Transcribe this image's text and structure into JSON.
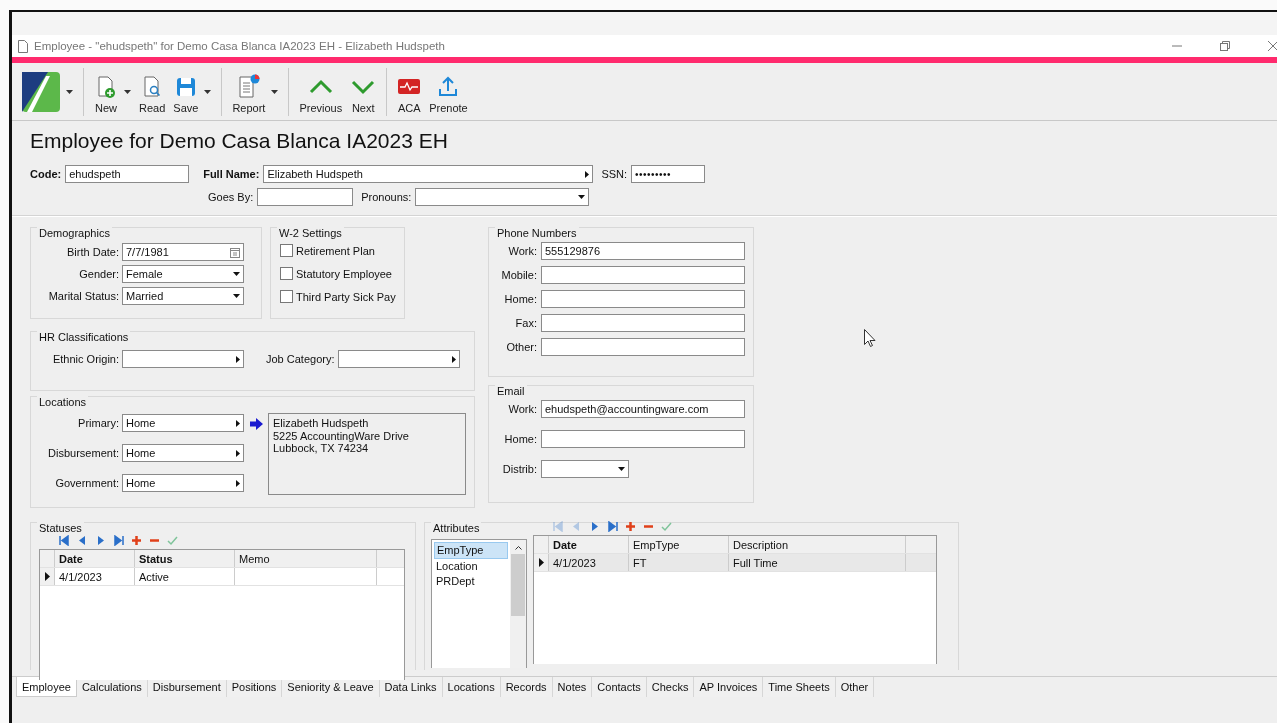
{
  "window": {
    "title": "Employee - \"ehudspeth\" for Demo Casa Blanca IA2023 EH - Elizabeth Hudspeth"
  },
  "toolbar": [
    {
      "has_menu": true
    },
    {
      "label": "New",
      "has_menu": true
    },
    {
      "label": "Read",
      "has_menu": false
    },
    {
      "label": "Save",
      "has_menu": true
    },
    {
      "label": "Report",
      "has_menu": true
    },
    {
      "label": "Previous",
      "has_menu": false
    },
    {
      "label": "Next",
      "has_menu": false
    },
    {
      "label": "ACA",
      "has_menu": false
    },
    {
      "label": "Prenote",
      "has_menu": false
    }
  ],
  "heading": "Employee for Demo Casa Blanca IA2023 EH",
  "header": {
    "code": {
      "label": "Code:",
      "value": "ehudspeth"
    },
    "full_name": {
      "label": "Full Name:",
      "value": "Elizabeth Hudspeth"
    },
    "ssn": {
      "label": "SSN:",
      "value": "•••••••••"
    },
    "goes_by": {
      "label": "Goes By:"
    },
    "pronouns": {
      "label": "Pronouns:"
    }
  },
  "demographics": {
    "title": "Demographics",
    "fields": [
      {
        "label": "Birth Date:",
        "value": "7/7/1981",
        "kind": "date"
      },
      {
        "label": "Gender:",
        "value": "Female",
        "kind": "dropdown"
      },
      {
        "label": "Marital Status:",
        "value": "Married",
        "kind": "dropdown"
      }
    ]
  },
  "w2_settings": {
    "title": "W-2 Settings",
    "checkboxes": [
      {
        "label": "Retirement Plan",
        "checked": false
      },
      {
        "label": "Statutory Employee",
        "checked": false
      },
      {
        "label": "Third Party Sick Pay",
        "checked": false
      }
    ]
  },
  "hr_classifications": {
    "title": "HR Classifications",
    "fields": [
      {
        "label": "Ethnic Origin:",
        "kind": "lookup"
      },
      {
        "label": "Job Category:",
        "kind": "lookup"
      }
    ]
  },
  "locations": {
    "title": "Locations",
    "fields": [
      {
        "label": "Primary:",
        "value": "Home",
        "kind": "lookup"
      },
      {
        "label": "Disbursement:",
        "value": "Home",
        "kind": "lookup"
      },
      {
        "label": "Government:",
        "value": "Home",
        "kind": "lookup"
      }
    ],
    "address": [
      "Elizabeth Hudspeth",
      "5225 AccountingWare Drive",
      "Lubbock, TX 74234"
    ]
  },
  "phone_numbers": {
    "title": "Phone Numbers",
    "fields": [
      {
        "label": "Work:",
        "value": "555129876"
      },
      {
        "label": "Mobile:"
      },
      {
        "label": "Home:"
      },
      {
        "label": "Fax:"
      },
      {
        "label": "Other:"
      }
    ]
  },
  "email": {
    "title": "Email",
    "fields": [
      {
        "label": "Work:",
        "value": "ehudspeth@accountingware.com",
        "kind": "text"
      },
      {
        "label": "Home:",
        "kind": "text"
      },
      {
        "label": "Distrib:",
        "kind": "dropdown"
      }
    ]
  },
  "statuses": {
    "title": "Statuses",
    "nav": [
      {
        "disabled": false
      },
      {
        "disabled": false
      },
      {
        "disabled": false
      },
      {
        "disabled": false
      },
      {
        "disabled": false
      },
      {
        "disabled": false
      },
      {
        "disabled": false
      }
    ],
    "columns": [
      {
        "label": "Date",
        "bold": true
      },
      {
        "label": "Status",
        "bold": true
      },
      {
        "label": "Memo",
        "bold": false
      }
    ],
    "rows": [
      {
        "cells": [
          "4/1/2023",
          "Active",
          ""
        ],
        "selected": false
      }
    ]
  },
  "attributes": {
    "title": "Attributes",
    "list": [
      {
        "label": "EmpType",
        "selected": true
      },
      {
        "label": "Location",
        "selected": false
      },
      {
        "label": "PRDept",
        "selected": false
      }
    ],
    "nav": [
      {
        "disabled": true
      },
      {
        "disabled": true
      },
      {
        "disabled": false
      },
      {
        "disabled": false
      },
      {
        "disabled": false
      },
      {
        "disabled": false
      },
      {
        "disabled": false
      }
    ],
    "columns": [
      {
        "label": "Date",
        "bold": true
      },
      {
        "label": "EmpType",
        "bold": false
      },
      {
        "label": "Description",
        "bold": false
      }
    ],
    "rows": [
      {
        "cells": [
          "4/1/2023",
          "FT",
          "Full Time"
        ],
        "selected": true
      }
    ]
  },
  "tabs": [
    {
      "label": "Employee",
      "selected": true
    },
    {
      "label": "Calculations",
      "selected": false
    },
    {
      "label": "Disbursement",
      "selected": false
    },
    {
      "label": "Positions",
      "selected": false
    },
    {
      "label": "Seniority & Leave",
      "selected": false
    },
    {
      "label": "Data Links",
      "selected": false
    },
    {
      "label": "Locations",
      "selected": false
    },
    {
      "label": "Records",
      "selected": false
    },
    {
      "label": "Notes",
      "selected": false
    },
    {
      "label": "Contacts",
      "selected": false
    },
    {
      "label": "Checks",
      "selected": false
    },
    {
      "label": "AP Invoices",
      "selected": false
    },
    {
      "label": "Time Sheets",
      "selected": false
    },
    {
      "label": "Other",
      "selected": false
    }
  ]
}
